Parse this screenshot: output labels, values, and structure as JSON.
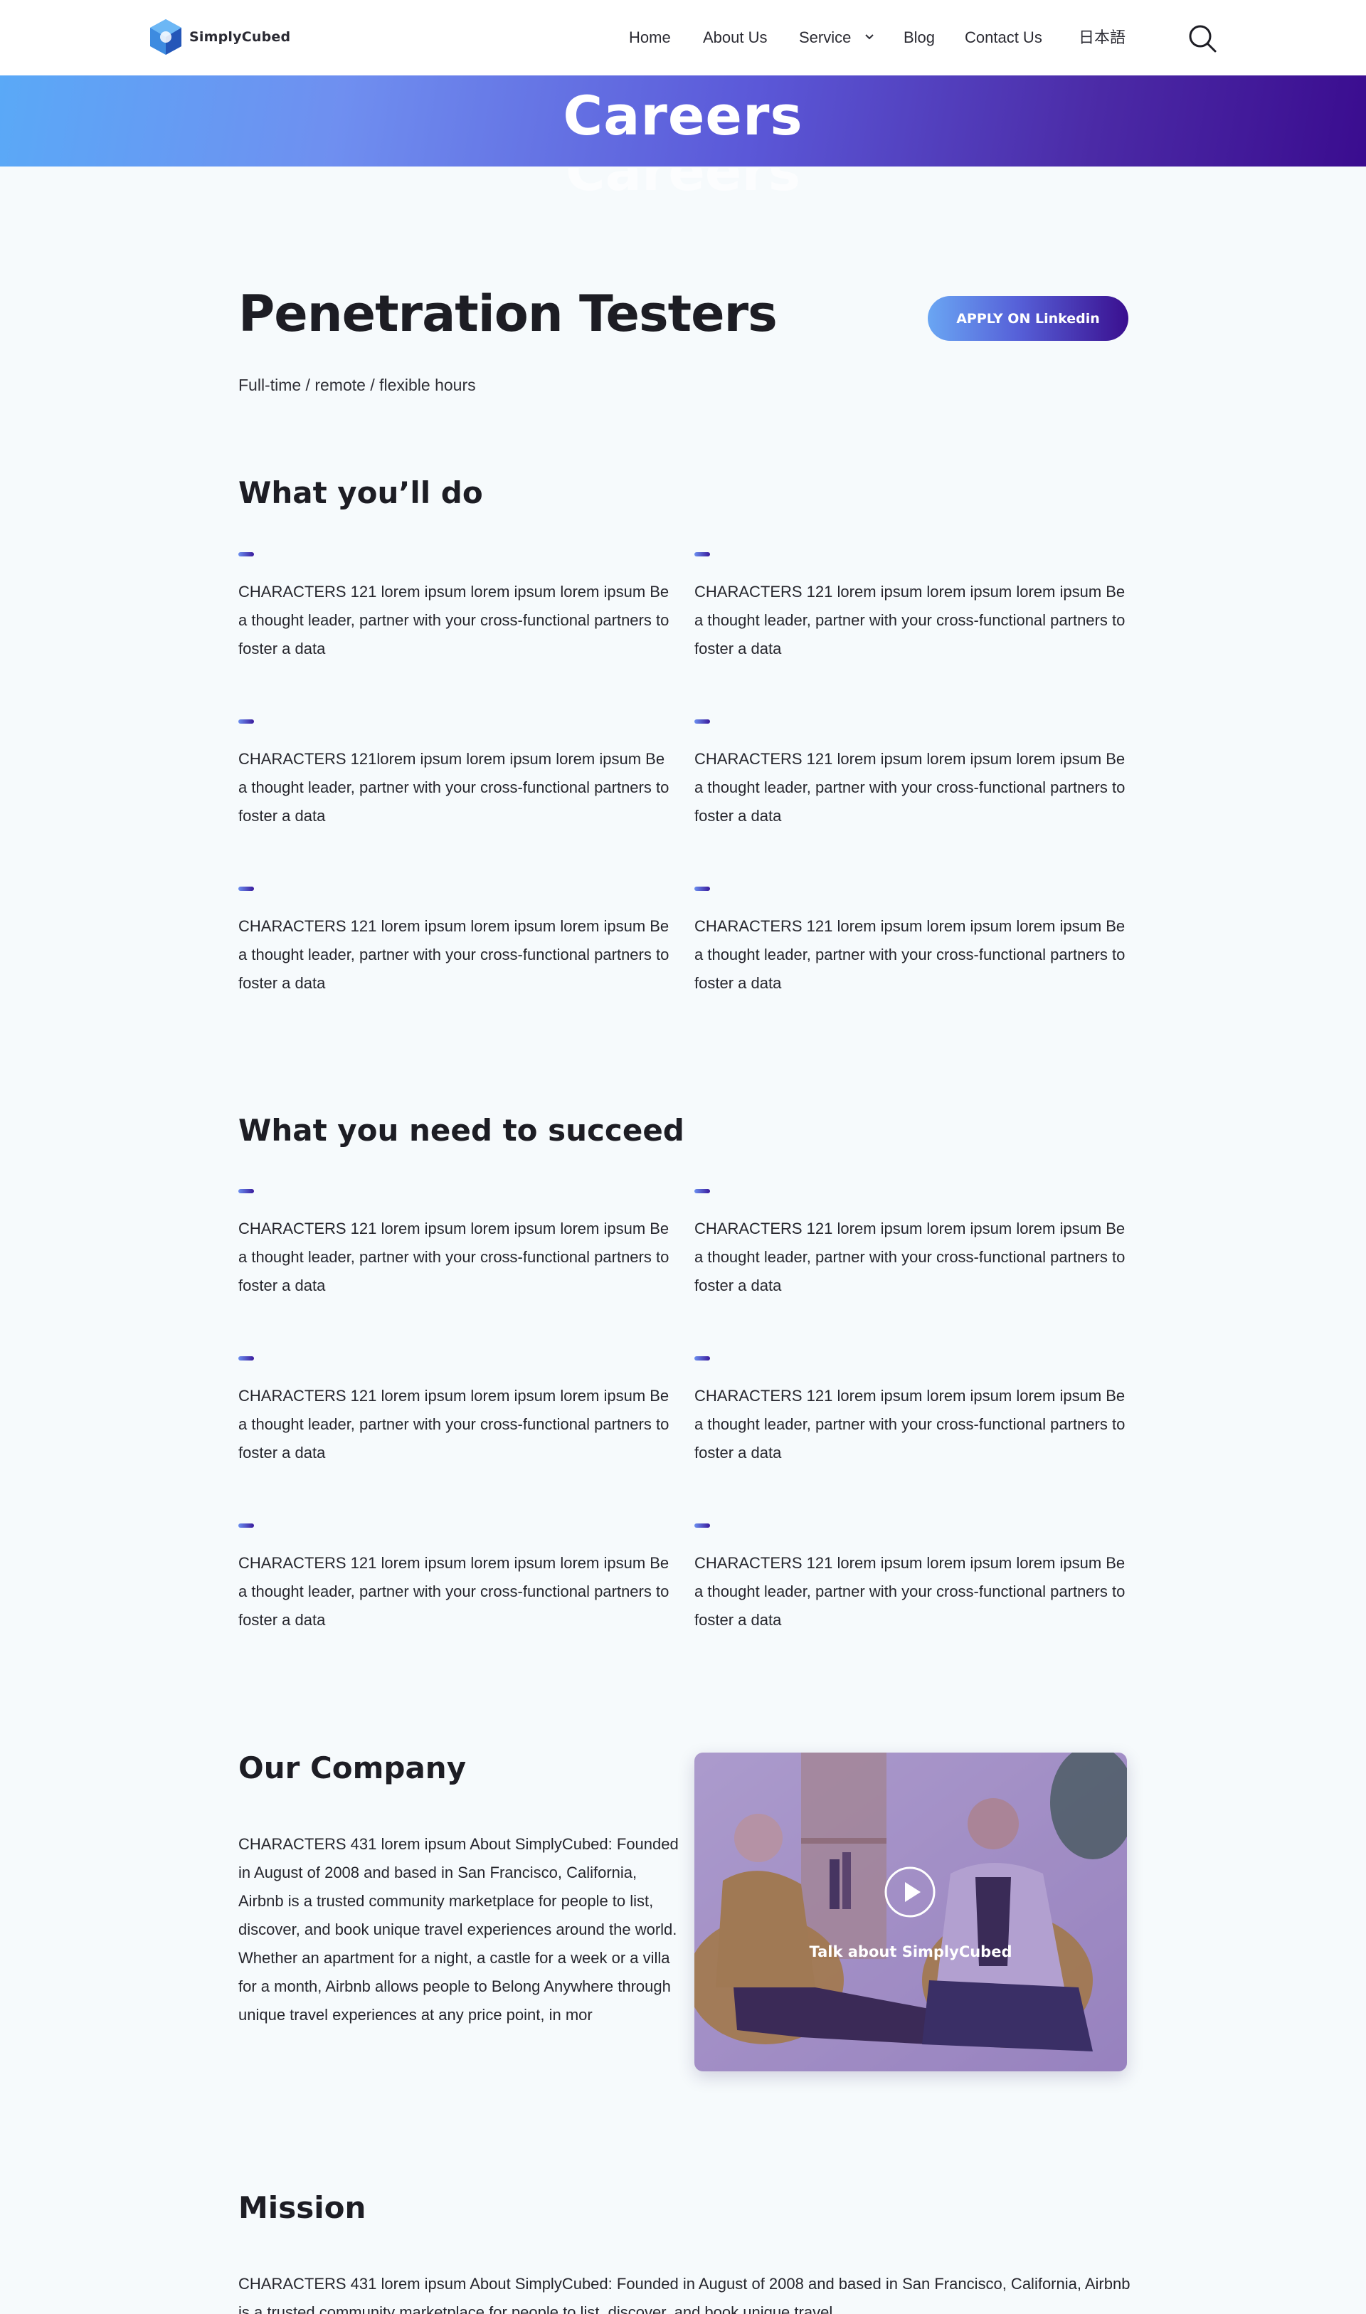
{
  "header": {
    "brand": "SimplyCubed",
    "nav": [
      {
        "label": "Home"
      },
      {
        "label": "About Us"
      },
      {
        "label": "Service"
      },
      {
        "label": "Blog"
      },
      {
        "label": "Contact Us"
      },
      {
        "label": "日本語"
      }
    ],
    "icons": {
      "search": "search-icon",
      "dropdown": "chevron-down-icon"
    }
  },
  "banner": {
    "title": "Careers"
  },
  "job": {
    "title": "Penetration Testers",
    "apply_label": "APPLY ON Linkedin",
    "meta": "Full-time / remote / flexible hours"
  },
  "sections": {
    "do": {
      "title": "What you’ll do",
      "items": [
        "CHARACTERS 121 lorem ipsum  lorem ipsum  lorem ipsum Be a thought leader, partner with your cross-functional partners to foster a data",
        "CHARACTERS 121 lorem ipsum  lorem ipsum  lorem ipsum Be a thought leader, partner with your cross-functional partners to foster a data",
        "CHARACTERS 121lorem ipsum  lorem ipsum  lorem ipsum Be a thought leader, partner with your cross-functional partners to foster a data",
        "CHARACTERS 121 lorem ipsum  lorem ipsum  lorem ipsum Be a thought leader, partner with your cross-functional partners to foster a data",
        "CHARACTERS 121 lorem ipsum  lorem ipsum  lorem ipsum Be a thought leader, partner with your cross-functional partners to foster a data",
        "CHARACTERS 121 lorem ipsum  lorem ipsum  lorem ipsum Be a thought leader, partner with your cross-functional partners to foster a data"
      ]
    },
    "succeed": {
      "title": "What you need to succeed",
      "items": [
        "CHARACTERS 121 lorem ipsum  lorem ipsum  lorem ipsum Be a thought leader, partner with your cross-functional partners to foster a data",
        "CHARACTERS 121 lorem ipsum  lorem ipsum  lorem ipsum Be a thought leader, partner with your cross-functional partners to foster a data",
        "CHARACTERS 121 lorem ipsum  lorem ipsum  lorem ipsum Be a thought leader, partner with your cross-functional partners to foster a data",
        "CHARACTERS 121 lorem ipsum  lorem ipsum  lorem ipsum Be a thought leader, partner with your cross-functional partners to foster a data",
        "CHARACTERS 121 lorem ipsum  lorem ipsum  lorem ipsum Be a thought leader, partner with your cross-functional partners to foster a data",
        "CHARACTERS 121 lorem ipsum  lorem ipsum  lorem ipsum Be a thought leader, partner with your cross-functional partners to foster a data"
      ]
    },
    "company": {
      "title": "Our Company",
      "text": "CHARACTERS 431  lorem ipsum About SimplyCubed: Founded in August of 2008 and based in San Francisco, California, Airbnb is a trusted community marketplace for people to list, discover, and book unique travel experiences around the world. Whether an apartment for a night, a castle for a week or a villa for a month, Airbnb allows people to Belong Anywhere through unique travel experiences at any price point, in mor",
      "video_caption": "Talk about SimplyCubed"
    },
    "mission": {
      "title": "Mission",
      "text": "CHARACTERS 431  lorem ipsum About SimplyCubed: Founded in August of 2008 and based in San Francisco, California, Airbnb is a trusted community marketplace for people to list, discover, and book unique travel"
    }
  },
  "colors": {
    "accent_start": "#5aa9f7",
    "accent_end": "#3a0c8f",
    "page_bg": "#f6fafc",
    "text": "#1d1d24"
  }
}
